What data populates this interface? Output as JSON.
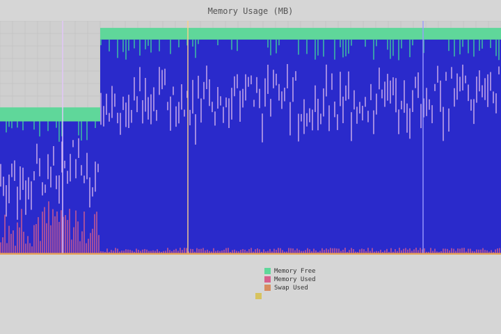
{
  "window": {
    "title": "Memory Usage (MB)"
  },
  "chart_data": {
    "type": "area",
    "title": "Memory Usage (MB)",
    "x_ticks": [
      "",
      "",
      "",
      "",
      "",
      "",
      "",
      "",
      ""
    ],
    "y_ticks": [],
    "series": [
      {
        "name": "Memory Free",
        "color": "#5fd79a"
      },
      {
        "name": "Memory Used",
        "color": "#d75f8c"
      },
      {
        "name": "Swap Used",
        "color": "#d78c5f"
      },
      {
        "name": "",
        "color": "#2a2acb"
      },
      {
        "name": "",
        "color": "#b59be6"
      }
    ],
    "segments": [
      {
        "x_range": [
          0,
          0.2
        ],
        "total_level": 0.63,
        "fill_level": 0.57,
        "band_level": 0.28,
        "low_level": 0.1
      },
      {
        "x_range": [
          0.2,
          1.0
        ],
        "total_level": 0.97,
        "fill_level": 0.92,
        "band_level": 0.6,
        "low_level": 0.03
      }
    ],
    "grid": true
  },
  "legend": {
    "rows": [
      {
        "left_label": "",
        "left_value": "",
        "mid_label": "",
        "mid_value": "",
        "key_label": "Memory Free",
        "key_color": "#5fd79a",
        "right_label": "",
        "right_value": ""
      },
      {
        "left_label": "",
        "left_value": "",
        "mid_label": "",
        "mid_value": "",
        "key_label": "Memory Used",
        "key_color": "#d75f8c",
        "right_label": "",
        "right_value": ""
      },
      {
        "left_label": "",
        "left_value": "",
        "mid_label": "",
        "mid_value": "",
        "key_label": "Swap Used",
        "key_color": "#d78c5f",
        "right_label": "",
        "right_value": ""
      },
      {
        "left_label": "",
        "left_value": "",
        "mid_label": "",
        "mid_value": "",
        "key_label": "",
        "key_color": "#d7c35f",
        "right_label": "",
        "right_value": ""
      },
      {
        "left_label": "",
        "left_value": "",
        "mid_label": "",
        "mid_value": "",
        "key_label": "",
        "key_color": "",
        "right_label": "",
        "right_value": ""
      }
    ],
    "footer": ""
  }
}
